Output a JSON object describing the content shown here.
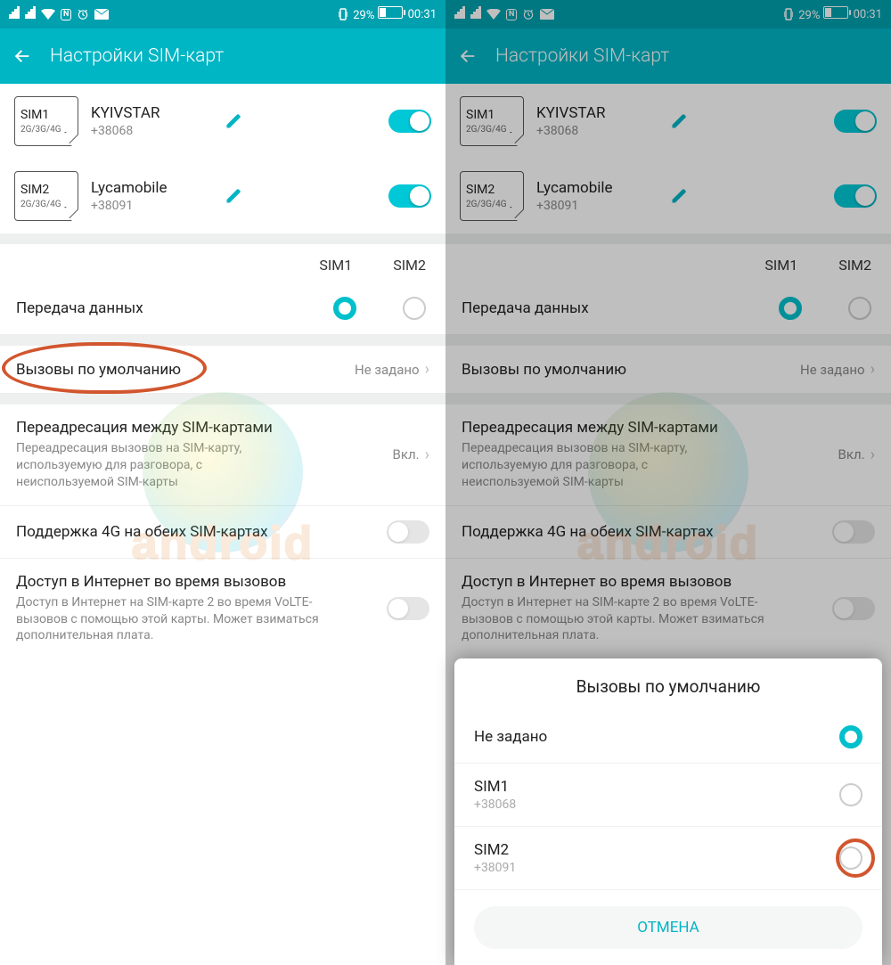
{
  "status": {
    "battery": "29%",
    "time": "00:31",
    "nfc": "N"
  },
  "header": {
    "title": "Настройки SIM-карт"
  },
  "sims": [
    {
      "slot": "SIM1",
      "tech": "2G/3G/4G",
      "name": "KYIVSTAR",
      "number": "+38068",
      "on": true
    },
    {
      "slot": "SIM2",
      "tech": "2G/3G/4G",
      "name": "Lycamobile",
      "number": "+38091",
      "on": true
    }
  ],
  "columns": {
    "c1": "SIM1",
    "c2": "SIM2"
  },
  "rows": {
    "data": "Передача данных",
    "calls": {
      "title": "Вызовы по умолчанию",
      "value": "Не задано"
    },
    "fwd": {
      "title": "Переадресация между SIM-картами",
      "sub": "Переадресация вызовов на SIM-карту, используемую для разговора, с неиспользуемой SIM-карты",
      "value": "Вкл."
    },
    "g4": "Поддержка 4G на обеих SIM-картах",
    "inet": {
      "title": "Доступ в Интернет во время вызовов",
      "sub": "Доступ в Интернет на SIM-карте 2 во время VoLTE-вызовов с помощью этой карты. Может взиматься дополнительная плата."
    }
  },
  "sheet": {
    "title": "Вызовы по умолчанию",
    "opts": [
      {
        "name": "Не задано",
        "number": "",
        "selected": true
      },
      {
        "name": "SIM1",
        "number": "+38068",
        "selected": false
      },
      {
        "name": "SIM2",
        "number": "+38091",
        "selected": false
      }
    ],
    "cancel": "ОТМЕНА"
  }
}
